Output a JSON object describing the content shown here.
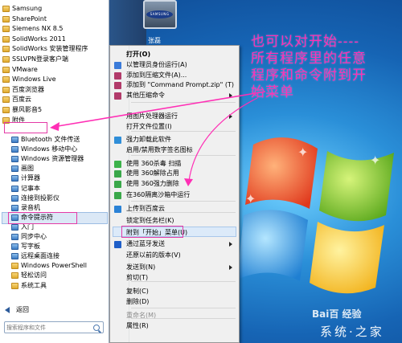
{
  "start_menu": {
    "programs": [
      {
        "label": "Samsung",
        "type": "folder"
      },
      {
        "label": "SharePoint",
        "type": "folder"
      },
      {
        "label": "Siemens NX 8.5",
        "type": "folder"
      },
      {
        "label": "SolidWorks 2011",
        "type": "folder"
      },
      {
        "label": "SolidWorks 安装管理程序",
        "type": "folder"
      },
      {
        "label": "SSLVPN登录客户端",
        "type": "folder"
      },
      {
        "label": "VMware",
        "type": "folder"
      },
      {
        "label": "Windows Live",
        "type": "folder"
      },
      {
        "label": "百度浏览器",
        "type": "folder"
      },
      {
        "label": "百度云",
        "type": "folder"
      },
      {
        "label": "暴风影音5",
        "type": "folder"
      },
      {
        "label": "附件",
        "type": "folder"
      }
    ],
    "accessories": [
      {
        "label": "Bluetooth 文件传送"
      },
      {
        "label": "Windows 移动中心"
      },
      {
        "label": "Windows 资源管理器"
      },
      {
        "label": "画图"
      },
      {
        "label": "计算器"
      },
      {
        "label": "记事本"
      },
      {
        "label": "连接到投影仪"
      },
      {
        "label": "录音机"
      },
      {
        "label": "命令提示符"
      },
      {
        "label": "入门"
      },
      {
        "label": "同步中心"
      },
      {
        "label": "写字板"
      },
      {
        "label": "远程桌面连接"
      },
      {
        "label": "Windows PowerShell",
        "type": "folder"
      },
      {
        "label": "轻松访问",
        "type": "folder"
      },
      {
        "label": "系统工具",
        "type": "folder"
      }
    ],
    "back_label": "返回",
    "search_placeholder": "搜索程序和文件"
  },
  "user": {
    "name": "张磊",
    "picture_text": "SAMSUNG"
  },
  "context_menu": {
    "items": [
      {
        "label": "打开(O)",
        "bold": true
      },
      {
        "label": "以管理员身份运行(A)",
        "icon": "shield-icon"
      },
      {
        "label": "添加到压缩文件(A)...",
        "icon": "archive-icon"
      },
      {
        "label": "添加到 \"Command Prompt.zip\" (T)",
        "icon": "archive-icon"
      },
      {
        "label": "其他压缩命令",
        "icon": "archive-icon",
        "submenu": true
      },
      {
        "label": "用图片处理器运行",
        "submenu": true
      },
      {
        "label": "打开文件位置(I)"
      },
      {
        "label": "强力卸载此软件",
        "icon": "uninstall-icon"
      },
      {
        "label": "启用/禁用数字签名图标"
      },
      {
        "label": "使用 360杀毒 扫描",
        "icon": "antivirus-icon"
      },
      {
        "label": "使用 360解除占用",
        "icon": "unlock-icon"
      },
      {
        "label": "使用 360强力删除",
        "icon": "delete-icon"
      },
      {
        "label": "在360隔离沙箱中运行",
        "icon": "sandbox-icon"
      },
      {
        "label": "上传到百度云",
        "icon": "cloud-upload-icon"
      },
      {
        "label": "锁定到任务栏(K)"
      },
      {
        "label": "附到「开始」菜单(U)"
      },
      {
        "label": "通过蓝牙发送",
        "icon": "bluetooth-icon",
        "submenu": true
      },
      {
        "label": "还原以前的版本(V)"
      },
      {
        "label": "发送到(N)",
        "submenu": true
      },
      {
        "label": "剪切(T)"
      },
      {
        "label": "复制(C)"
      },
      {
        "label": "删除(D)"
      },
      {
        "label": "重命名(M)",
        "disabled": true
      },
      {
        "label": "属性(R)"
      }
    ]
  },
  "annotation": "也可以对开始----所有程序里的任意程序和命令附到开始菜单",
  "watermark": {
    "line1": "Bai百 经验",
    "line2": "系统·之家"
  },
  "colors": {
    "annotation": "#ff2fb5",
    "highlight": "#e43aa6"
  }
}
